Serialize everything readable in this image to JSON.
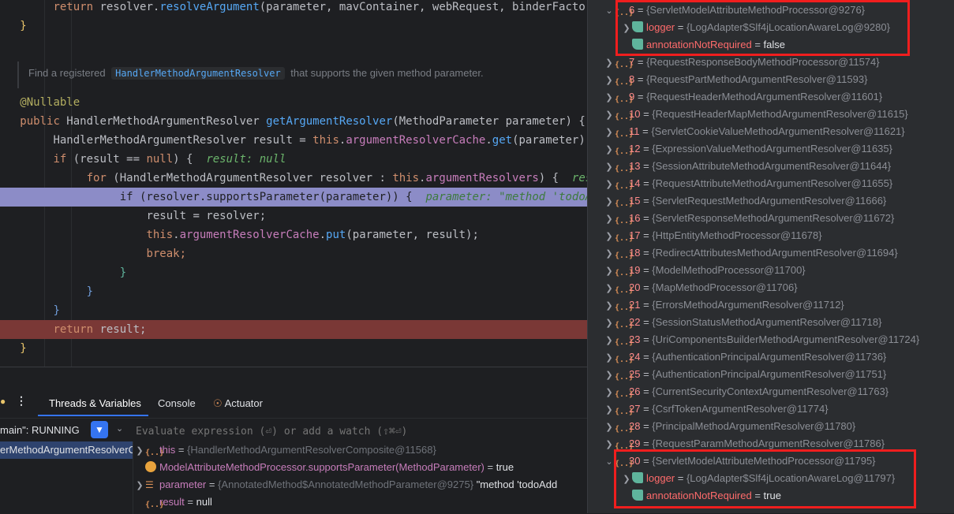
{
  "editor": {
    "lines": {
      "l1": {
        "kw": "return",
        "rest": " resolver.",
        "fn": "resolveArgument",
        "args": "(parameter, mavContainer, webRequest, binderFactory"
      },
      "doc": {
        "prefix": "Find a registered ",
        "code": "HandlerMethodArgumentResolver",
        "suffix": " that supports the given method parameter."
      },
      "annotation": "@Nullable",
      "sig": {
        "kw": "public",
        "type": " HandlerMethodArgumentResolver ",
        "fn": "getArgumentResolver",
        "params": "(MethodParameter parameter) {"
      },
      "l5": {
        "type": "HandlerMethodArgumentResolver result = ",
        "kw": "this",
        "dot": ".",
        "field": "argumentResolverCache",
        "dot2": ".",
        "fn": "get",
        "args": "(parameter);"
      },
      "l6": {
        "kw": "if",
        "cond": " (result == ",
        "kw2": "null",
        "close": ") {",
        "hint": "result: null"
      },
      "l7": {
        "kw": "for",
        "cond": " (HandlerMethodArgumentResolver resolver : ",
        "kw2": "this",
        "dot": ".",
        "field": "argumentResolvers",
        "close": ") {",
        "hint": "reso"
      },
      "l8": {
        "kw": "if",
        "cond": " (resolver.supportsParameter(parameter)) {",
        "hint": "parameter: \"method 'todoAdd"
      },
      "l9": "result = resolver;",
      "l10": {
        "kw": "this",
        "dot": ".",
        "field": "argumentResolverCache",
        "dot2": ".",
        "fn": "put",
        "args": "(parameter, result);"
      },
      "l11": "break;",
      "ret": {
        "kw": "return",
        "rest": " result;"
      }
    }
  },
  "debug": {
    "tabs": [
      {
        "label": "Threads & Variables"
      },
      {
        "label": "Console"
      },
      {
        "label": "Actuator"
      }
    ],
    "thread_status": "main\": RUNNING",
    "eval_placeholder": "Evaluate expression (⏎) or add a watch (⇧⌘⏎)",
    "frame": "erMethodArgumentResolverC",
    "vars": [
      {
        "name": "this",
        "eq": " = ",
        "type": "{HandlerMethodArgumentResolverComposite@11568}",
        "val": ""
      },
      {
        "name": "ModelAttributeMethodProcessor.supportsParameter(MethodParameter)",
        "eq": " = ",
        "type": "",
        "val": "true"
      },
      {
        "name": "parameter",
        "eq": " = ",
        "type": "{AnnotatedMethod$AnnotatedMethodParameter@9275}",
        "val": " \"method 'todoAdd"
      },
      {
        "name": "result",
        "eq": " = ",
        "type": "",
        "val": "null"
      }
    ]
  },
  "tree": {
    "top_group": {
      "idx": "6",
      "type": "{ServletModelAttributeMethodProcessor@9276}",
      "logger": {
        "name": "logger",
        "type": "{LogAdapter$Slf4jLocationAwareLog@9280}"
      },
      "flag": {
        "name": "annotationNotRequired",
        "val": "false"
      }
    },
    "items": [
      {
        "idx": "7",
        "type": "{RequestResponseBodyMethodProcessor@11574}"
      },
      {
        "idx": "8",
        "type": "{RequestPartMethodArgumentResolver@11593}"
      },
      {
        "idx": "9",
        "type": "{RequestHeaderMethodArgumentResolver@11601}"
      },
      {
        "idx": "10",
        "type": "{RequestHeaderMapMethodArgumentResolver@11615}"
      },
      {
        "idx": "11",
        "type": "{ServletCookieValueMethodArgumentResolver@11621}"
      },
      {
        "idx": "12",
        "type": "{ExpressionValueMethodArgumentResolver@11635}"
      },
      {
        "idx": "13",
        "type": "{SessionAttributeMethodArgumentResolver@11644}"
      },
      {
        "idx": "14",
        "type": "{RequestAttributeMethodArgumentResolver@11655}"
      },
      {
        "idx": "15",
        "type": "{ServletRequestMethodArgumentResolver@11666}"
      },
      {
        "idx": "16",
        "type": "{ServletResponseMethodArgumentResolver@11672}"
      },
      {
        "idx": "17",
        "type": "{HttpEntityMethodProcessor@11678}"
      },
      {
        "idx": "18",
        "type": "{RedirectAttributesMethodArgumentResolver@11694}"
      },
      {
        "idx": "19",
        "type": "{ModelMethodProcessor@11700}"
      },
      {
        "idx": "20",
        "type": "{MapMethodProcessor@11706}"
      },
      {
        "idx": "21",
        "type": "{ErrorsMethodArgumentResolver@11712}"
      },
      {
        "idx": "22",
        "type": "{SessionStatusMethodArgumentResolver@11718}"
      },
      {
        "idx": "23",
        "type": "{UriComponentsBuilderMethodArgumentResolver@11724}"
      },
      {
        "idx": "24",
        "type": "{AuthenticationPrincipalArgumentResolver@11736}"
      },
      {
        "idx": "25",
        "type": "{AuthenticationPrincipalArgumentResolver@11751}"
      },
      {
        "idx": "26",
        "type": "{CurrentSecurityContextArgumentResolver@11763}"
      },
      {
        "idx": "27",
        "type": "{CsrfTokenArgumentResolver@11774}"
      },
      {
        "idx": "28",
        "type": "{PrincipalMethodArgumentResolver@11780}"
      },
      {
        "idx": "29",
        "type": "{RequestParamMethodArgumentResolver@11786}"
      }
    ],
    "bottom_group": {
      "idx": "30",
      "type": "{ServletModelAttributeMethodProcessor@11795}",
      "logger": {
        "name": "logger",
        "type": "{LogAdapter$Slf4jLocationAwareLog@11797}"
      },
      "flag": {
        "name": "annotationNotRequired",
        "val": "true"
      }
    },
    "eq": " = "
  },
  "colors": {
    "highlight_box": "#f01e1e",
    "exec_line": "#8c8cc7",
    "break_line": "#7a3836"
  }
}
